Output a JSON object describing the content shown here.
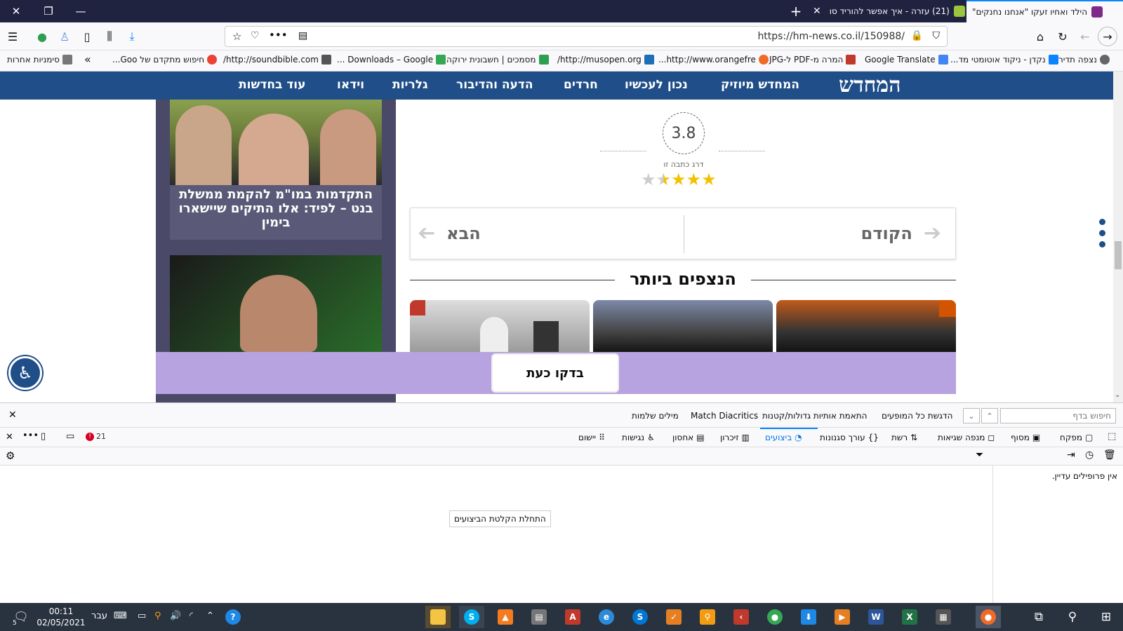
{
  "browser": {
    "tabs": [
      {
        "title": "הילד ואחיו זעקו \"אנחנו נחנקים\"",
        "active": true
      },
      {
        "title": "(21) עזרה - איך אפשר להוריד סו",
        "active": false
      }
    ],
    "new_tab_label": "+",
    "url": "https://hm-news.co.il/150988/",
    "bookmarks_more_label": "סימניות אחרות",
    "bookmarks": [
      "נצפה תדיר",
      "נקדן - ניקוד אוטומטי מד...",
      "Google Translate",
      "המרה מ-PDF ל-JPG",
      "http://www.orangefre...",
      "http://musopen.org/",
      "מסמכים | חשבונית ירוקה",
      "Downloads – Google ...",
      "http://soundbible.com/",
      "חיפוש מתקדם של Goo..."
    ]
  },
  "site": {
    "logo": "המחדש",
    "nav": [
      "המחדש מיוזיק",
      "נכון לעכשיו",
      "חרדים",
      "הדעה והדיבור",
      "גלריות",
      "וידאו",
      "עוד בחדשות"
    ],
    "sidebar_card_title": "התקדמות במו\"מ להקמת ממשלת בנט – לפיד: אלו התיקים שיישארו בימין",
    "rating": {
      "value": "3.8",
      "label": "דרג כתבה זו",
      "stars_shown": 3.5,
      "stars_total": 5
    },
    "pager": {
      "prev": "הקודם",
      "next": "הבא"
    },
    "most_viewed_title": "הנצפים ביותר",
    "banner_button": "בדקו כעת"
  },
  "findbar": {
    "placeholder": "חיפוש בדף",
    "highlight_all": "הדגשת כל המופעים",
    "match_case": "התאמת אותיות גדולות/קטנות",
    "match_diacritics": "Match Diacritics",
    "whole_words": "מילים שלמות"
  },
  "devtools": {
    "tabs": [
      "מפקח",
      "מסוף",
      "מנפה שגיאות",
      "רשת",
      "עורך סגנונות",
      "ביצועים",
      "זיכרון",
      "אחסון",
      "נגישות",
      "יישום"
    ],
    "selected_tab": "ביצועים",
    "error_count": "21",
    "no_profiles": "אין פרופילים עדיין.",
    "start_recording": "התחלת הקלטת הביצועים"
  },
  "taskbar": {
    "time": "00:11",
    "date": "02/05/2021",
    "lang": "עבר",
    "notification_count": "5"
  },
  "colors": {
    "site_nav": "#1f4e88",
    "banner": "#b7a3df",
    "tabstrip": "#202340",
    "taskbar": "#29323f",
    "accent": "#0a84ff"
  }
}
